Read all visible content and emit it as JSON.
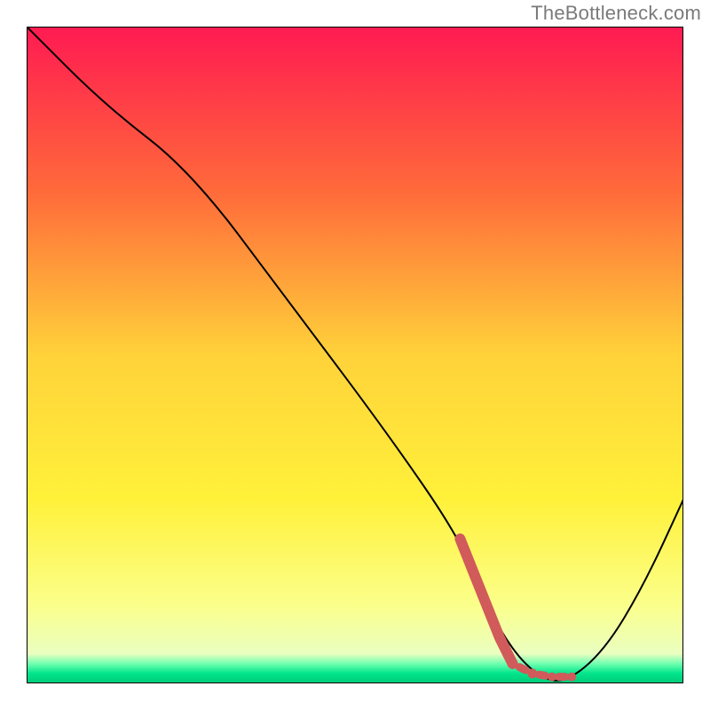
{
  "attribution": "TheBottleneck.com",
  "colors": {
    "curve": "#000000",
    "marker": "#d15a5a",
    "gradient_stops": [
      {
        "offset": 0.0,
        "color": "#ff1a52"
      },
      {
        "offset": 0.25,
        "color": "#ff6a3a"
      },
      {
        "offset": 0.5,
        "color": "#ffd23a"
      },
      {
        "offset": 0.72,
        "color": "#fff13a"
      },
      {
        "offset": 0.88,
        "color": "#fbff8a"
      },
      {
        "offset": 0.955,
        "color": "#eaffc0"
      },
      {
        "offset": 0.97,
        "color": "#6fffb0"
      },
      {
        "offset": 0.985,
        "color": "#00e58a"
      },
      {
        "offset": 1.0,
        "color": "#00c97a"
      }
    ]
  },
  "chart_data": {
    "type": "line",
    "title": "",
    "xlabel": "",
    "ylabel": "",
    "xlim": [
      0,
      100
    ],
    "ylim": [
      0,
      100
    ],
    "series": [
      {
        "name": "bottleneck_curve",
        "x": [
          0,
          12,
          25,
          40,
          55,
          66,
          70,
          74,
          78,
          82,
          88,
          94,
          100
        ],
        "y": [
          100,
          88,
          78,
          58,
          38,
          22,
          12,
          5,
          1,
          0,
          5,
          15,
          28
        ]
      }
    ],
    "markers": [
      {
        "name": "optimal_segment_start",
        "x": 66,
        "y": 22
      },
      {
        "name": "optimal_segment_a",
        "x": 70,
        "y": 12
      },
      {
        "name": "optimal_segment_b",
        "x": 72,
        "y": 7
      },
      {
        "name": "optimal_segment_c",
        "x": 74,
        "y": 3
      },
      {
        "name": "optimal_point_d",
        "x": 77,
        "y": 1.5
      },
      {
        "name": "optimal_point_e",
        "x": 80,
        "y": 1
      },
      {
        "name": "optimal_point_f",
        "x": 83,
        "y": 1
      }
    ]
  }
}
